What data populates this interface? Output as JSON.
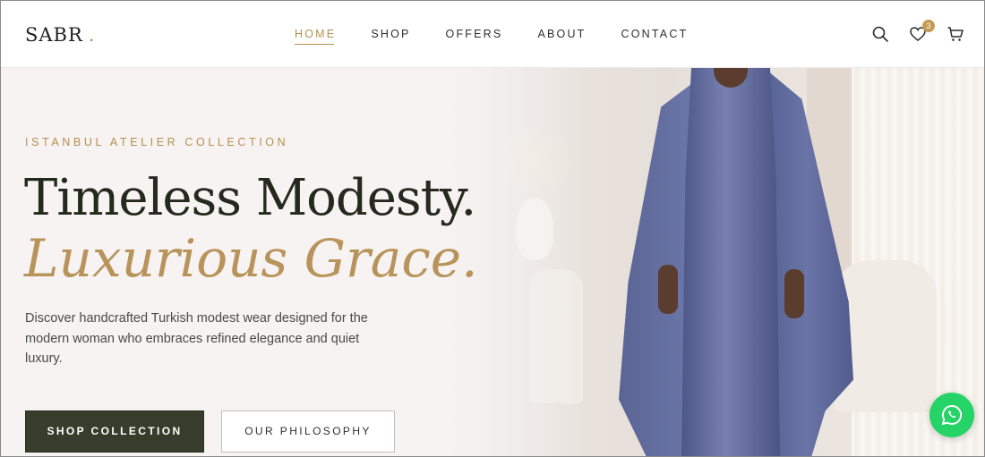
{
  "header": {
    "logo_text": "SABR",
    "logo_dot": ".",
    "nav": [
      {
        "label": "HOME",
        "active": true
      },
      {
        "label": "SHOP",
        "active": false
      },
      {
        "label": "OFFERS",
        "active": false
      },
      {
        "label": "ABOUT",
        "active": false
      },
      {
        "label": "CONTACT",
        "active": false
      }
    ],
    "icons": [
      "search-icon",
      "heart-icon",
      "cart-icon"
    ],
    "wishlist_count": "3"
  },
  "hero": {
    "eyebrow": "ISTANBUL ATELIER COLLECTION",
    "title_line1": "Timeless Modesty.",
    "title_line2": "Luxurious Grace.",
    "description": "Discover handcrafted Turkish modest wear designed for the modern woman who embraces refined elegance and quiet luxury.",
    "primary_button": "SHOP COLLECTION",
    "secondary_button": "OUR PHILOSOPHY"
  },
  "floating": {
    "whatsapp_icon": "whatsapp-icon"
  },
  "colors": {
    "accent_gold": "#b78f4f",
    "dark_olive": "#363d2b",
    "dress_blue": "#5a6495",
    "whatsapp_green": "#25d366"
  }
}
